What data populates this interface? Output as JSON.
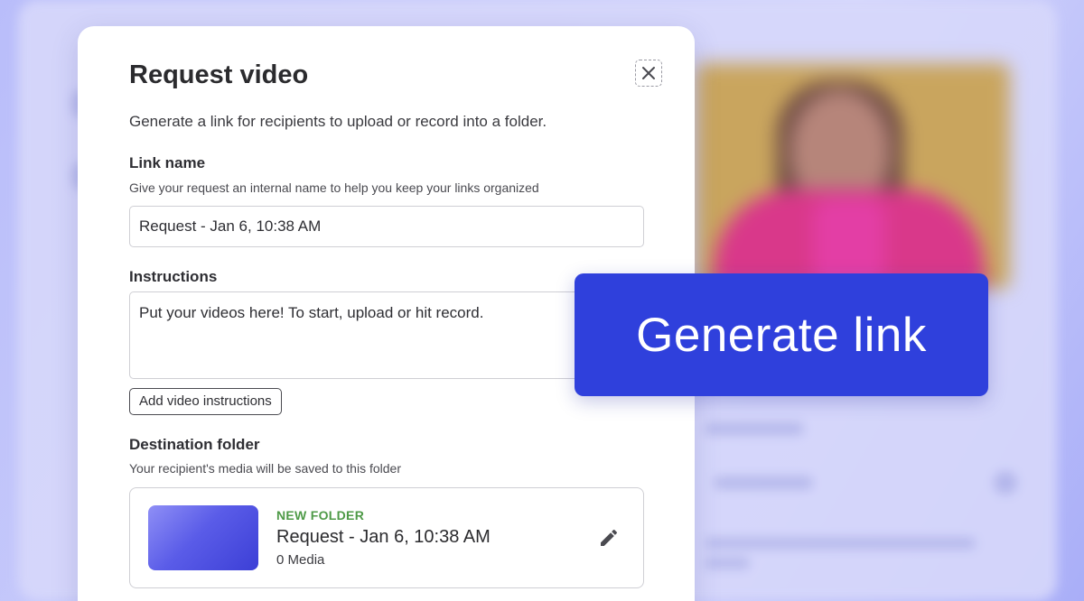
{
  "modal": {
    "title": "Request video",
    "description": "Generate a link for recipients to upload or record into a folder.",
    "link_name": {
      "label": "Link name",
      "help": "Give your request an internal name to help you keep your links organized",
      "value": "Request - Jan 6, 10:38 AM"
    },
    "instructions": {
      "label": "Instructions",
      "value": "Put your videos here! To start, upload or hit record.",
      "add_button": "Add video instructions"
    },
    "destination": {
      "label": "Destination folder",
      "help": "Your recipient's media will be saved to this folder",
      "folder_tag": "NEW FOLDER",
      "folder_name": "Request - Jan 6, 10:38 AM",
      "folder_count": "0 Media"
    }
  },
  "cta": {
    "label": "Generate link"
  },
  "icons": {
    "close": "close-icon",
    "edit": "pencil-icon"
  },
  "colors": {
    "accent": "#2f40dc",
    "folder_tag": "#4e9a47",
    "background": "#c8cbfb"
  }
}
